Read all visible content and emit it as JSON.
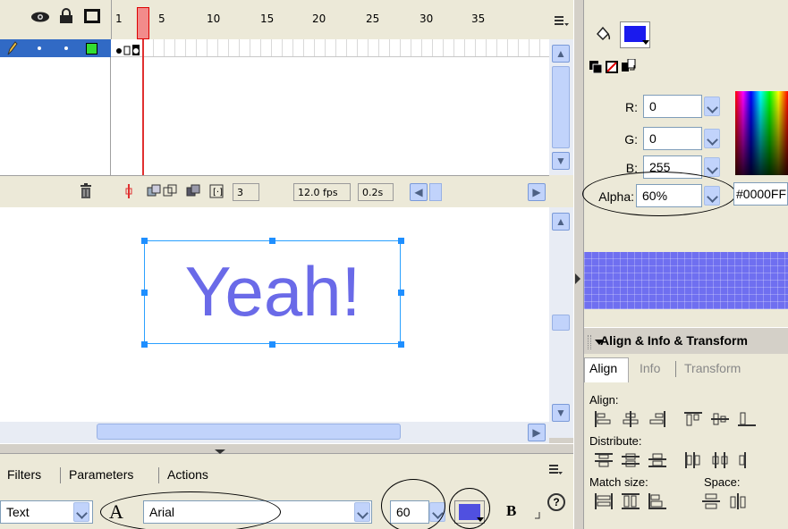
{
  "timeline": {
    "ruler_labels": [
      "1",
      "5",
      "10",
      "15",
      "20",
      "25",
      "30",
      "35"
    ],
    "current_frame": "3",
    "fps": "12.0 fps",
    "elapsed_time": "0.2s"
  },
  "stage": {
    "text_content": "Yeah!",
    "text_color": "#6a6ae8",
    "selection_color": "#2aa0ff"
  },
  "properties": {
    "tabs": [
      "Filters",
      "Parameters",
      "Actions"
    ],
    "text_type": "Text",
    "font_name": "Arial",
    "font_size": "60",
    "bold_label": "B",
    "help_label": "?"
  },
  "color_mixer": {
    "r_label": "R:",
    "r_value": "0",
    "g_label": "G:",
    "g_value": "0",
    "b_label": "B:",
    "b_value": "255",
    "alpha_label": "Alpha:",
    "alpha_value": "60%",
    "hex_value": "#0000FF",
    "fill_color": "#0000ff"
  },
  "align_panel": {
    "title": "Align & Info & Transform",
    "tabs": [
      "Align",
      "Info",
      "Transform"
    ],
    "align_label": "Align:",
    "distribute_label": "Distribute:",
    "match_size_label": "Match size:",
    "space_label": "Space:"
  }
}
